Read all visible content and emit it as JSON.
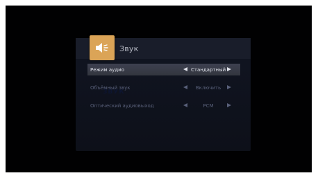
{
  "header": {
    "title": "Звук",
    "icon": "speaker-icon",
    "icon_color": "#dba457"
  },
  "rows": [
    {
      "label": "Режим аудио",
      "value": "Стандартный",
      "selected": true
    },
    {
      "label": "Объёмный звук",
      "value": "Включить",
      "selected": false
    },
    {
      "label": "Оптический аудиовыход",
      "value": "PCM",
      "selected": false
    }
  ],
  "colors": {
    "screen_bg": "#010102",
    "panel_bg": "#111522",
    "selected_row_bg": "#3d4050",
    "selected_text": "#e0e2ea",
    "dim_text": "#59607a"
  }
}
